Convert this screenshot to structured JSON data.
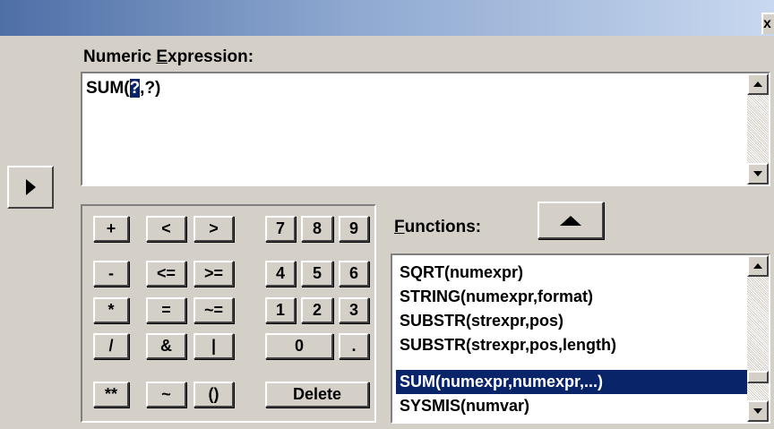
{
  "window": {
    "close_glyph": "x"
  },
  "expression": {
    "label_prefix": "Numeric ",
    "label_mnemonic": "E",
    "label_suffix": "xpression:",
    "value_before": "SUM(",
    "value_selected": "?",
    "value_after": ",?)"
  },
  "transfer_button": {
    "icon": "right-arrow-icon"
  },
  "keypad": {
    "keys": [
      "+",
      "<",
      ">",
      "7",
      "8",
      "9",
      "-",
      "<=",
      ">=",
      "4",
      "5",
      "6",
      "*",
      "=",
      "~=",
      "1",
      "2",
      "3",
      "/",
      "&",
      "|",
      "0",
      ".",
      "**",
      "~",
      "()",
      "Delete"
    ]
  },
  "functions": {
    "label_mnemonic": "F",
    "label_suffix": "unctions:",
    "up_button_icon": "up-arrow-icon",
    "items": [
      "SQRT(numexpr)",
      "STRING(numexpr,format)",
      "SUBSTR(strexpr,pos)",
      "SUBSTR(strexpr,pos,length)",
      "SUM(numexpr,numexpr,...)",
      "SYSMIS(numvar)"
    ],
    "selected_index": 4
  },
  "colors": {
    "face": "#d4d0c8",
    "highlight": "#0a246a",
    "title_gradient_start": "#4e6fa6"
  }
}
